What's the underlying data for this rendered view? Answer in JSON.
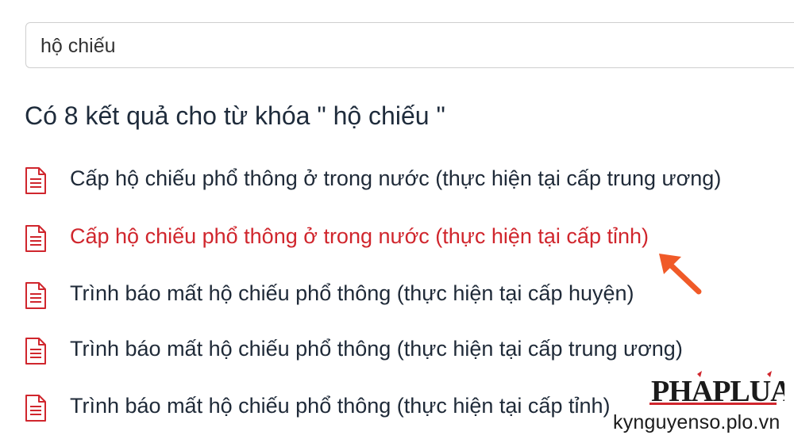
{
  "search": {
    "value": "hộ chiếu"
  },
  "results": {
    "heading": "Có 8 kết quả cho từ khóa \" hộ chiếu \"",
    "items": [
      {
        "label": "Cấp hộ chiếu phổ thông ở trong nước (thực hiện tại cấp trung ương)",
        "icon": "document-icon",
        "highlighted": false
      },
      {
        "label": "Cấp hộ chiếu phổ thông ở trong nước (thực hiện tại cấp tỉnh)",
        "icon": "document-icon",
        "highlighted": true
      },
      {
        "label": "Trình báo mất hộ chiếu phổ thông (thực hiện tại cấp huyện)",
        "icon": "document-icon",
        "highlighted": false
      },
      {
        "label": "Trình báo mất hộ chiếu phổ thông (thực hiện tại cấp trung ương)",
        "icon": "document-icon",
        "highlighted": false
      },
      {
        "label": "Trình báo mất hộ chiếu phổ thông (thực hiện tại cấp tỉnh)",
        "icon": "document-icon",
        "highlighted": false
      }
    ]
  },
  "annotation": {
    "icon": "arrow-icon",
    "color": "#f05a28"
  },
  "watermark": {
    "logo_text": "PHAPLUAT",
    "url": "kynguyenso.plo.vn"
  },
  "colors": {
    "heading": "#1e2b3b",
    "link": "#1f2a38",
    "link_active": "#d0262d",
    "icon": "#d0262d",
    "search_border": "#cfcfcf"
  }
}
